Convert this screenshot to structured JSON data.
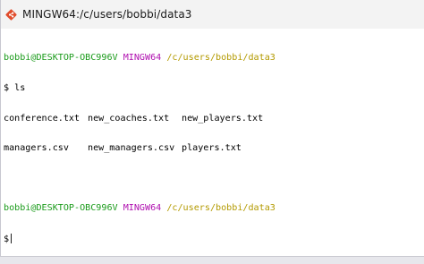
{
  "window": {
    "title": "MINGW64:/c/users/bobbi/data3"
  },
  "terminal": {
    "prompt1": {
      "user_host": "bobbi@DESKTOP-OBC996V",
      "env": "MINGW64",
      "path": "/c/users/bobbi/data3"
    },
    "command": "$ ls",
    "listing": [
      [
        "conference.txt",
        "new_coaches.txt",
        "new_players.txt"
      ],
      [
        "managers.csv",
        "new_managers.csv",
        "players.txt"
      ]
    ],
    "prompt2": {
      "user_host": "bobbi@DESKTOP-OBC996V",
      "env": "MINGW64",
      "path": "/c/users/bobbi/data3"
    },
    "input_prompt": "$"
  },
  "colors": {
    "user_host": "#1a9b1a",
    "env": "#b010b0",
    "path": "#b39a00",
    "text": "#000000",
    "background": "#ffffff"
  },
  "icons": {
    "app": "git-bash-icon"
  }
}
